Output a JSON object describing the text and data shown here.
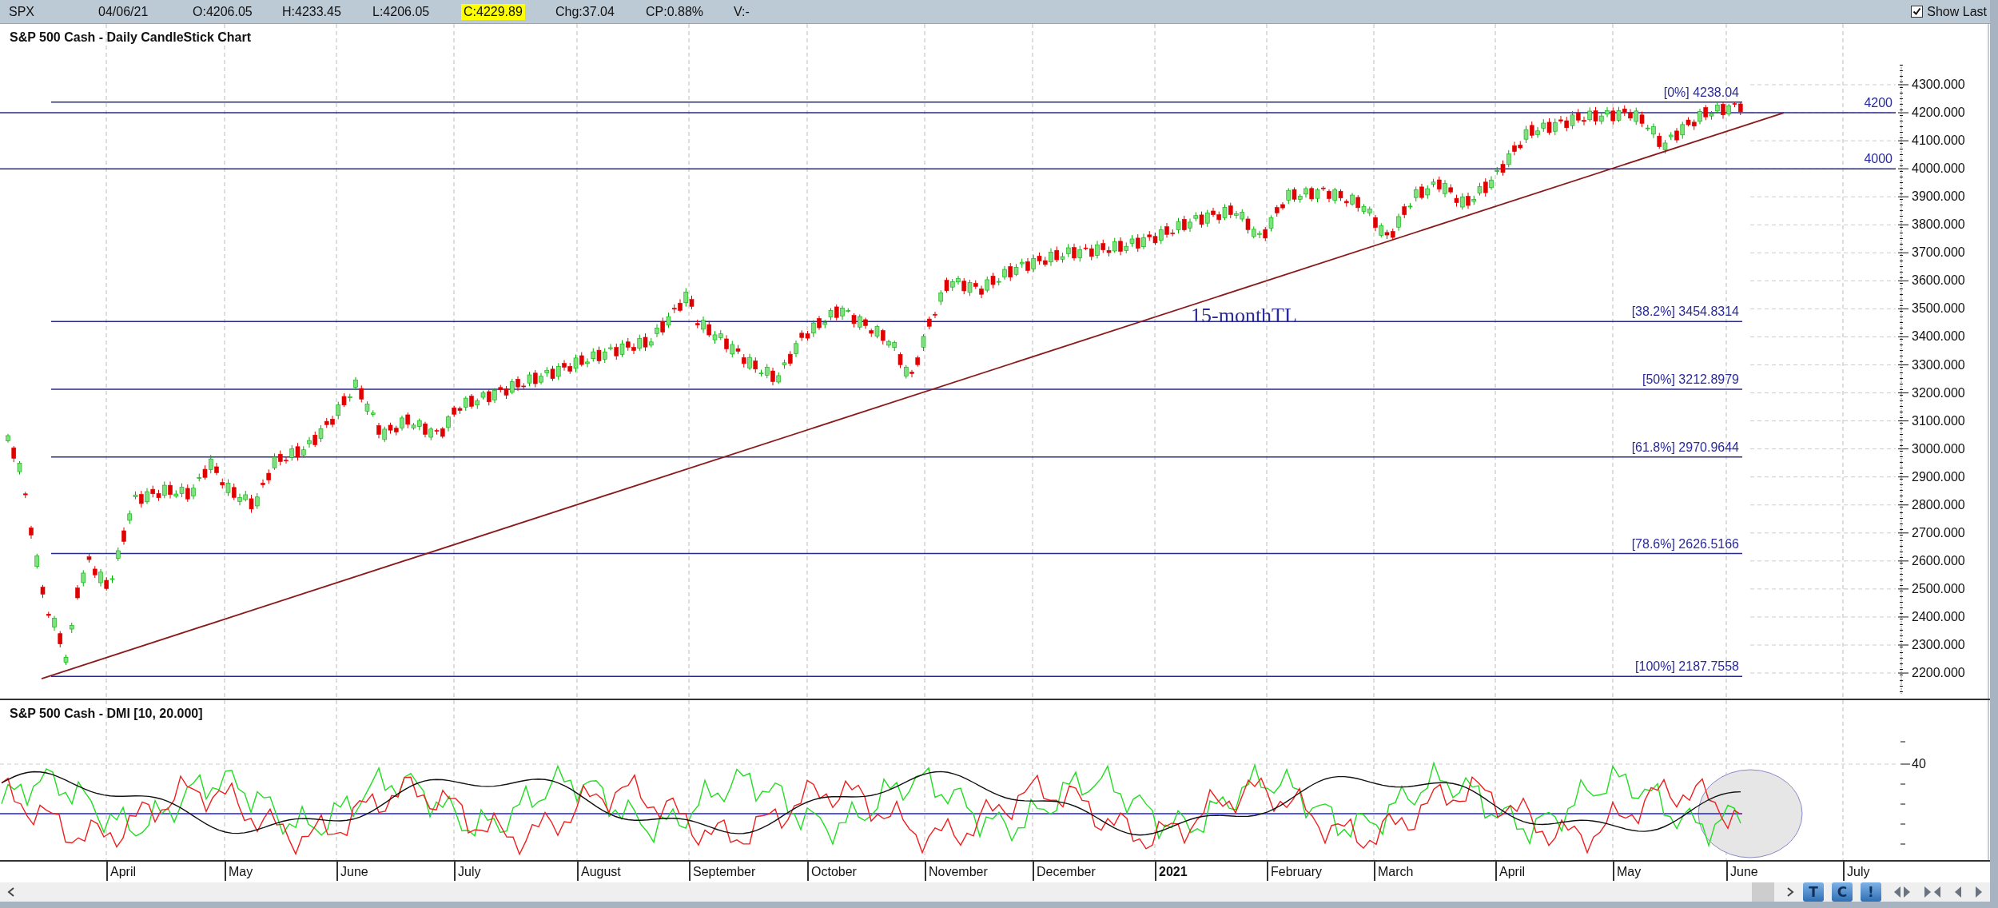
{
  "quote_bar": {
    "symbol": "SPX",
    "date": "04/06/21",
    "fields": [
      {
        "text": "O:4206.05",
        "highlighted": false
      },
      {
        "text": "H:4233.45",
        "highlighted": false
      },
      {
        "text": "L:4206.05",
        "highlighted": false
      },
      {
        "text": "C:4229.89",
        "highlighted": true
      },
      {
        "text": "Chg:37.04",
        "highlighted": false
      },
      {
        "text": "CP:0.88%",
        "highlighted": false
      },
      {
        "text": "V:-",
        "highlighted": false
      }
    ],
    "show_last": {
      "label": "Show Last",
      "checked": true
    }
  },
  "price_chart": {
    "title": "S&P 500 Cash - Daily CandleStick Chart",
    "y_ticks": [
      "4300.000",
      "4200.000",
      "4100.000",
      "4000.000",
      "3900.000",
      "3800.000",
      "3700.000",
      "3600.000",
      "3500.000",
      "3400.000",
      "3300.000",
      "3200.000",
      "3100.000",
      "3000.000",
      "2900.000",
      "2800.000",
      "2700.000",
      "2600.000",
      "2500.000",
      "2400.000",
      "2300.000",
      "2200.000"
    ],
    "retracements": [
      {
        "label": "[0%] 4238.04"
      },
      {
        "label": "[38.2%] 3454.8314"
      },
      {
        "label": "[50%] 3212.8979"
      },
      {
        "label": "[61.8%] 2970.9644"
      },
      {
        "label": "[78.6%] 2626.5166"
      },
      {
        "label": "[100%] 2187.7558"
      }
    ],
    "levels": [
      {
        "label": "4200"
      },
      {
        "label": "4000"
      }
    ],
    "trendline_label": "15-monthTL"
  },
  "dmi_panel": {
    "title": "S&P 500 Cash - DMI [10, 20.000]",
    "y_tick": "40"
  },
  "time_axis": [
    {
      "label": "April",
      "kind": "month"
    },
    {
      "label": "May",
      "kind": "month"
    },
    {
      "label": "June",
      "kind": "month"
    },
    {
      "label": "July",
      "kind": "month"
    },
    {
      "label": "August",
      "kind": "month"
    },
    {
      "label": "September",
      "kind": "month"
    },
    {
      "label": "October",
      "kind": "month"
    },
    {
      "label": "November",
      "kind": "month"
    },
    {
      "label": "December",
      "kind": "month"
    },
    {
      "label": "2021",
      "kind": "year"
    },
    {
      "label": "February",
      "kind": "month"
    },
    {
      "label": "March",
      "kind": "month"
    },
    {
      "label": "April",
      "kind": "month"
    },
    {
      "label": "May",
      "kind": "month"
    },
    {
      "label": "June",
      "kind": "month"
    },
    {
      "label": "July",
      "kind": "month"
    }
  ],
  "toolbar": [
    {
      "glyph": "T"
    },
    {
      "glyph": "C"
    },
    {
      "glyph": "!"
    }
  ]
}
